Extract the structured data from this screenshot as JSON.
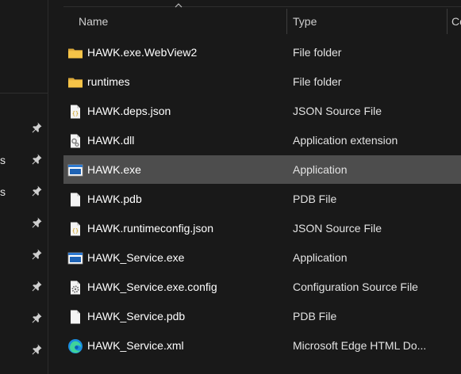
{
  "header": {
    "name": "Name",
    "type": "Type",
    "more": "Co"
  },
  "nav_stubs": [
    {
      "text": ""
    },
    {
      "text": "s"
    },
    {
      "text": "s"
    },
    {
      "text": ""
    },
    {
      "text": ""
    },
    {
      "text": ""
    },
    {
      "text": ""
    },
    {
      "text": ""
    }
  ],
  "files": [
    {
      "name": "HAWK.exe.WebView2",
      "type": "File folder",
      "icon": "folder-icon"
    },
    {
      "name": "runtimes",
      "type": "File folder",
      "icon": "folder-icon"
    },
    {
      "name": "HAWK.deps.json",
      "type": "JSON Source File",
      "icon": "json-file-icon"
    },
    {
      "name": "HAWK.dll",
      "type": "Application extension",
      "icon": "dll-file-icon"
    },
    {
      "name": "HAWK.exe",
      "type": "Application",
      "icon": "application-icon",
      "selected": true
    },
    {
      "name": "HAWK.pdb",
      "type": "PDB File",
      "icon": "blank-file-icon"
    },
    {
      "name": "HAWK.runtimeconfig.json",
      "type": "JSON Source File",
      "icon": "json-file-icon"
    },
    {
      "name": "HAWK_Service.exe",
      "type": "Application",
      "icon": "application-icon"
    },
    {
      "name": "HAWK_Service.exe.config",
      "type": "Configuration Source File",
      "icon": "config-file-icon"
    },
    {
      "name": "HAWK_Service.pdb",
      "type": "PDB File",
      "icon": "blank-file-icon"
    },
    {
      "name": "HAWK_Service.xml",
      "type": "Microsoft Edge HTML Do...",
      "icon": "edge-icon"
    }
  ]
}
